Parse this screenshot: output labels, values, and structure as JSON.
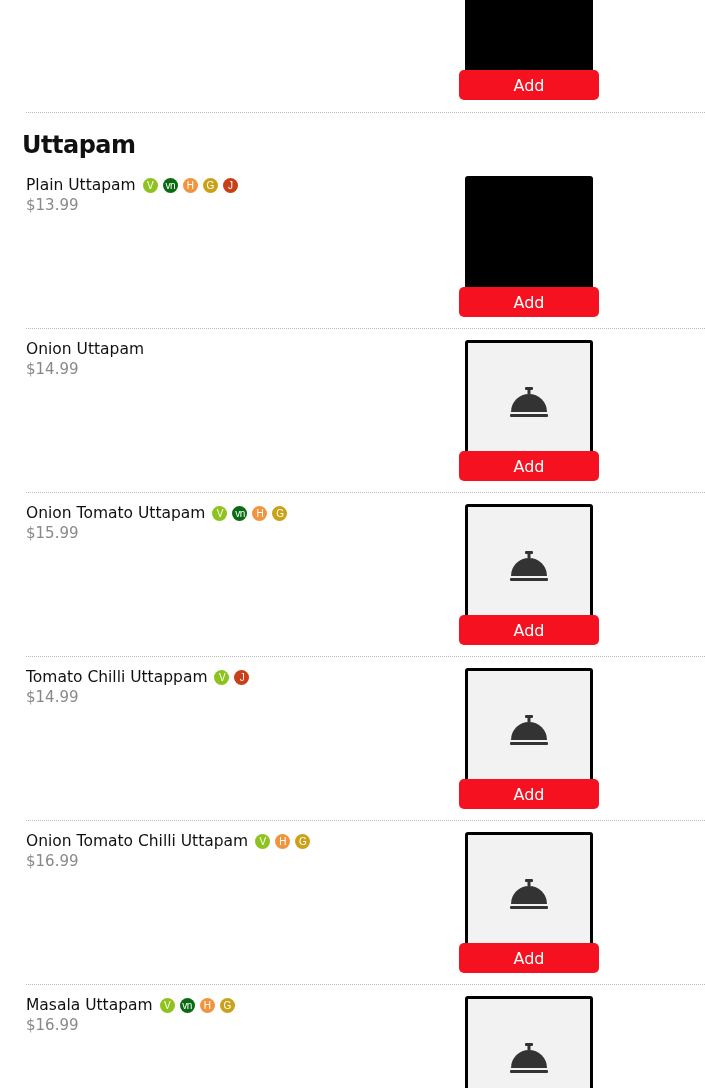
{
  "top_item": {
    "kind": "photo",
    "button": "Add"
  },
  "section": {
    "title": "Uttapam",
    "items": [
      {
        "name": "Plain Uttapam",
        "price": "$13.99",
        "kind": "photo",
        "button": "Add",
        "badges": [
          {
            "label": "V",
            "color": "#8dc21f"
          },
          {
            "label": "vn",
            "color": "#0b6b12"
          },
          {
            "label": "H",
            "color": "#f0953e"
          },
          {
            "label": "G",
            "color": "#c9a21a"
          },
          {
            "label": "J",
            "color": "#c8401a"
          }
        ]
      },
      {
        "name": "Onion Uttapam",
        "price": "$14.99",
        "kind": "placeholder",
        "button": "Add"
      },
      {
        "name": "Onion Tomato Uttapam",
        "price": "$15.99",
        "kind": "placeholder",
        "button": "Add",
        "badges": [
          {
            "label": "V",
            "color": "#8dc21f"
          },
          {
            "label": "vn",
            "color": "#0b6b12"
          },
          {
            "label": "H",
            "color": "#f0953e"
          },
          {
            "label": "G",
            "color": "#c9a21a"
          }
        ]
      },
      {
        "name": "Tomato Chilli Uttappam",
        "price": "$14.99",
        "kind": "placeholder",
        "button": "Add",
        "badges": [
          {
            "label": "V",
            "color": "#8dc21f"
          },
          {
            "label": "J",
            "color": "#c8401a"
          }
        ]
      },
      {
        "name": "Onion Tomato Chilli Uttapam",
        "price": "$16.99",
        "kind": "placeholder",
        "button": "Add",
        "badges": [
          {
            "label": "V",
            "color": "#8dc21f"
          },
          {
            "label": "H",
            "color": "#f0953e"
          },
          {
            "label": "G",
            "color": "#c9a21a"
          }
        ]
      },
      {
        "name": "Masala Uttapam",
        "price": "$16.99",
        "kind": "placeholder",
        "badges": [
          {
            "label": "V",
            "color": "#8dc21f"
          },
          {
            "label": "vn",
            "color": "#0b6b12"
          },
          {
            "label": "H",
            "color": "#f0953e"
          },
          {
            "label": "G",
            "color": "#c9a21a"
          }
        ]
      }
    ]
  }
}
